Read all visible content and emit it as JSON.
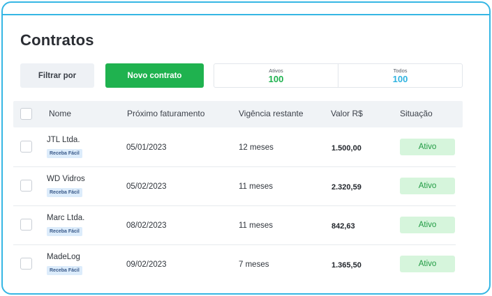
{
  "page": {
    "title": "Contratos"
  },
  "toolbar": {
    "filter_label": "Filtrar por",
    "new_label": "Novo contrato",
    "counters": [
      {
        "label": "Ativos",
        "value": "100",
        "color": "#1fb24f"
      },
      {
        "label": "Todos",
        "value": "100",
        "color": "#2fb3e0"
      }
    ]
  },
  "table": {
    "columns": [
      "Nome",
      "Próximo faturamento",
      "Vigência restante",
      "Valor R$",
      "Situação"
    ],
    "rows": [
      {
        "name": "JTL Ltda.",
        "tag": "Receba Fácil",
        "next_billing": "05/01/2023",
        "remaining": "12 meses",
        "value": "1.500,00",
        "status": "Ativo"
      },
      {
        "name": "WD Vidros",
        "tag": "Receba Fácil",
        "next_billing": "05/02/2023",
        "remaining": "11 meses",
        "value": "2.320,59",
        "status": "Ativo"
      },
      {
        "name": "Marc Ltda.",
        "tag": "Receba Fácil",
        "next_billing": "08/02/2023",
        "remaining": "11 meses",
        "value": "842,63",
        "status": "Ativo"
      },
      {
        "name": "MadeLog",
        "tag": "Receba Fácil",
        "next_billing": "09/02/2023",
        "remaining": "7 meses",
        "value": "1.365,50",
        "status": "Ativo"
      }
    ]
  },
  "colors": {
    "frame": "#35b6e4",
    "primary": "#1fb24f",
    "status_bg": "#d6f5dc",
    "status_text": "#1f9a42"
  }
}
